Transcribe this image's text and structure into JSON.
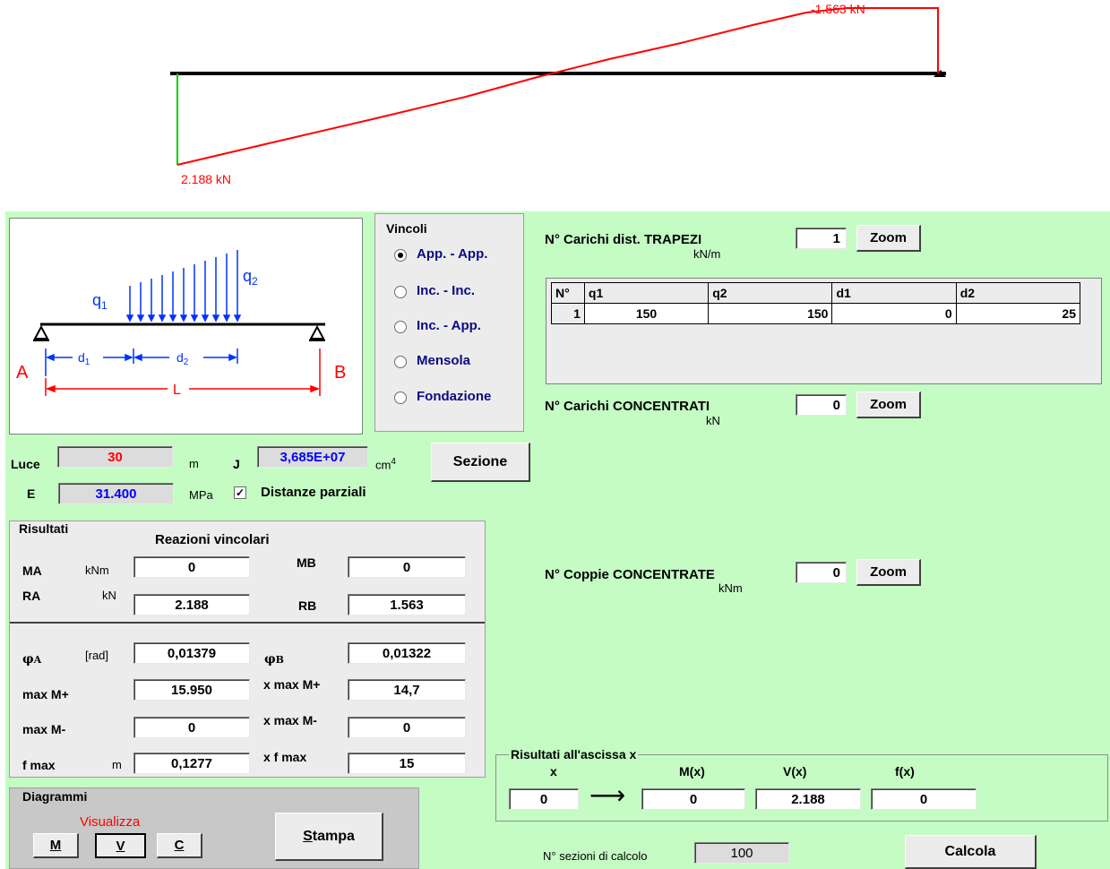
{
  "diagram": {
    "left_value": "2.188 kN",
    "right_value": "-1.563 kN"
  },
  "vincoli": {
    "title": "Vincoli",
    "options": [
      "App. - App.",
      "Inc. - Inc.",
      "Inc. - App.",
      "Mensola",
      "Fondazione"
    ],
    "selected": 0
  },
  "sketch": {
    "q1": "q",
    "q1_sub": "1",
    "q2": "q",
    "q2_sub": "2",
    "d1": "d",
    "d1_sub": "1",
    "d2": "d",
    "d2_sub": "2",
    "L": "L",
    "A": "A",
    "B": "B"
  },
  "trapezi": {
    "label": "N° Carichi dist. TRAPEZI",
    "unit": "kN/m",
    "count": "1",
    "zoom": "Zoom",
    "headers": [
      "N°",
      "q1",
      "q2",
      "d1",
      "d2"
    ],
    "rows": [
      [
        "1",
        "150",
        "150",
        "0",
        "25"
      ]
    ]
  },
  "concentrati": {
    "label": "N° Carichi CONCENTRATI",
    "unit": "kN",
    "count": "0",
    "zoom": "Zoom"
  },
  "coppie": {
    "label": "N° Coppie CONCENTRATE",
    "unit": "kNm",
    "count": "0",
    "zoom": "Zoom"
  },
  "props": {
    "luce_label": "Luce",
    "luce_value": "30",
    "luce_unit": "m",
    "j_label": "J",
    "j_value": "3,685E+07",
    "j_unit": "cm",
    "j_exp": "4",
    "e_label": "E",
    "e_value": "31.400",
    "e_unit": "MPa",
    "sezione": "Sezione",
    "distanze_label": "Distanze parziali",
    "distanze_checked": true
  },
  "colors": {
    "panel": "#c4fcc4",
    "red": "#ff0000",
    "blue": "#0000ff",
    "green": "#00cc00"
  },
  "risultati": {
    "title": "Risultati",
    "subtitle": "Reazioni vincolari",
    "ma_label": "MA",
    "ma_unit": "kNm",
    "ma_value": "0",
    "mb_label": "MB",
    "mb_value": "0",
    "ra_label": "RA",
    "ra_unit": "kN",
    "ra_value": "2.188",
    "rb_label": "RB",
    "rb_value": "1.563",
    "phia_label": "φ",
    "phia_sub": "A",
    "phia_unit": "[rad]",
    "phia_value": "0,01379",
    "phib_label": "φ",
    "phib_sub": "B",
    "phib_value": "0,01322",
    "maxmp_label": "max M+",
    "maxmp_value": "15.950",
    "xmaxmp_label": "x max M+",
    "xmaxmp_value": "14,7",
    "maxmm_label": "max M-",
    "maxmm_value": "0",
    "xmaxmm_label": "x max M-",
    "xmaxmm_value": "0",
    "fmax_label": "f max",
    "fmax_unit": "m",
    "fmax_value": "0,1277",
    "xfmax_label": "x f max",
    "xfmax_value": "15"
  },
  "ascissa": {
    "title": "Risultati all'ascissa x",
    "x_label": "x",
    "x_value": "0",
    "m_label": "M(x)",
    "m_value": "0",
    "v_label": "V(x)",
    "v_value": "2.188",
    "f_label": "f(x)",
    "f_value": "0"
  },
  "diagrammi": {
    "title": "Diagrammi",
    "visualizza": "Visualizza",
    "btn_m": "M",
    "btn_v": "V",
    "btn_c": "C",
    "stampa": "Stampa"
  },
  "footer": {
    "sezioni_label": "N° sezioni di calcolo",
    "sezioni_value": "100",
    "calcola": "Calcola"
  }
}
